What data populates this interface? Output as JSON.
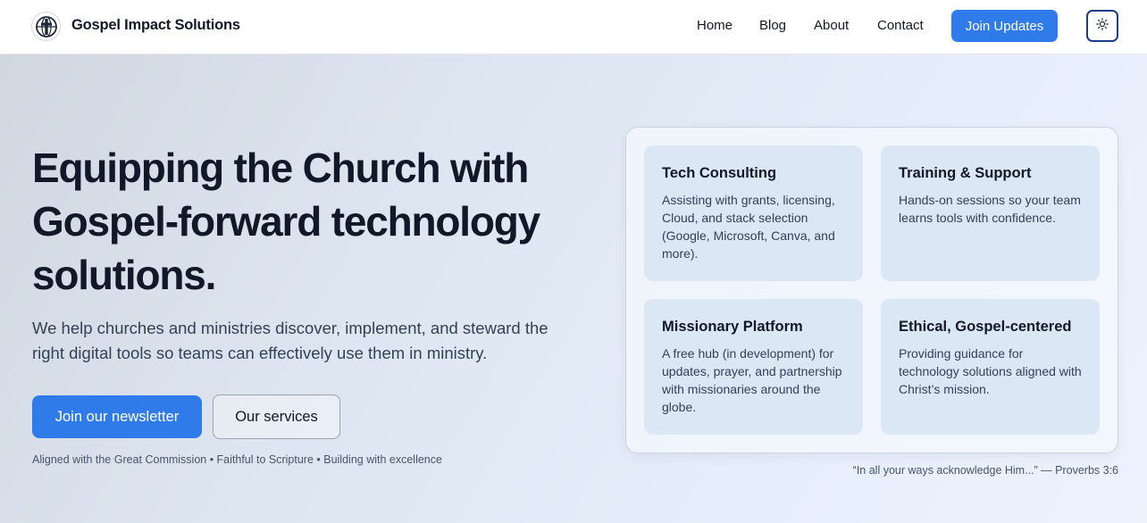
{
  "header": {
    "brand": "Gospel Impact Solutions",
    "logo_icon": "cross-globe-icon",
    "nav": [
      {
        "label": "Home"
      },
      {
        "label": "Blog"
      },
      {
        "label": "About"
      },
      {
        "label": "Contact"
      }
    ],
    "cta_label": "Join Updates",
    "theme_toggle_icon": "sun-icon"
  },
  "hero": {
    "title": "Equipping the Church with Gospel-forward technology solutions.",
    "subtitle": "We help churches and ministries discover, implement, and steward the right digital tools so teams can effectively use them in ministry.",
    "primary_button": "Join our newsletter",
    "secondary_button": "Our services",
    "tagline": "Aligned with the Great Commission • Faithful to Scripture • Building with excellence"
  },
  "services": [
    {
      "title": "Tech Consulting",
      "text": "Assisting with grants, licensing, Cloud, and stack selection (Google, Microsoft, Canva, and more)."
    },
    {
      "title": "Training & Support",
      "text": "Hands-on sessions so your team learns tools with confidence."
    },
    {
      "title": "Missionary Platform",
      "text": "A free hub (in development) for updates, prayer, and partnership with missionaries around the globe."
    },
    {
      "title": "Ethical, Gospel-centered",
      "text": "Providing guidance for technology solutions aligned with Christ’s mission."
    }
  ],
  "quote": "“In all your ways acknowledge Him...” — Proverbs 3:6",
  "colors": {
    "accent": "#2f7bea",
    "heading": "#111827",
    "card_bg": "#dce7f6",
    "theme_border": "#1e3a8a"
  }
}
